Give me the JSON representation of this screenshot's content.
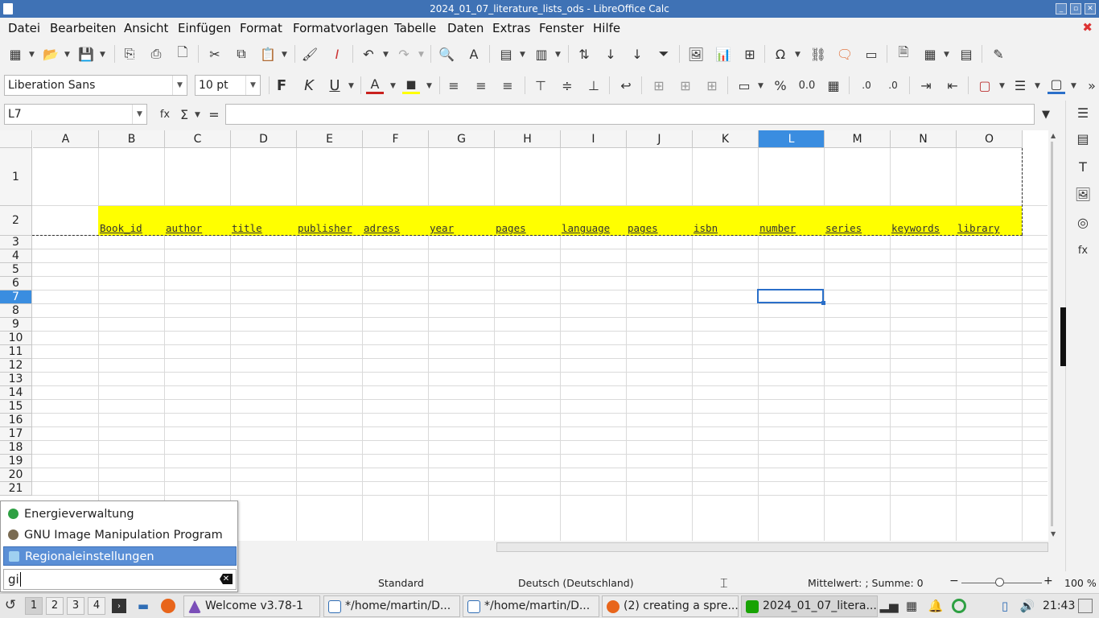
{
  "window": {
    "title": "2024_01_07_literature_lists_ods - LibreOffice Calc"
  },
  "menu": [
    "Datei",
    "Bearbeiten",
    "Ansicht",
    "Einfügen",
    "Format",
    "Formatvorlagen",
    "Tabelle",
    "Daten",
    "Extras",
    "Fenster",
    "Hilfe"
  ],
  "font": {
    "name": "Liberation Sans",
    "size": "10 pt"
  },
  "formula": {
    "cell_ref": "L7",
    "content": ""
  },
  "columns": [
    "A",
    "B",
    "C",
    "D",
    "E",
    "F",
    "G",
    "H",
    "I",
    "J",
    "K",
    "L",
    "M",
    "N",
    "O"
  ],
  "selected_column": "L",
  "rows": [
    "1",
    "2",
    "3",
    "4",
    "5",
    "6",
    "7",
    "8",
    "9",
    "10",
    "11",
    "12",
    "13",
    "14",
    "15",
    "16",
    "17",
    "18",
    "19",
    "20",
    "21"
  ],
  "selected_row": "7",
  "header_cells": [
    "Book_id",
    "author",
    "title",
    "publisher",
    "adress",
    "year",
    "pages",
    "language",
    "pages",
    "isbn",
    "number",
    "series",
    "keywords",
    "library"
  ],
  "header_fill": "#ffff00",
  "status": {
    "style": "Standard",
    "language": "Deutsch (Deutschland)",
    "sum": "Mittelwert: ; Summe: 0",
    "zoom": "100 %"
  },
  "popup": {
    "items": [
      "Energieverwaltung",
      "GNU Image Manipulation Program",
      "Regionaleinstellungen"
    ],
    "highlighted": "Regionaleinstellungen",
    "search_text": "gi"
  },
  "taskbar": {
    "workspaces": [
      "1",
      "2",
      "3",
      "4"
    ],
    "tasks": [
      "Welcome v3.78-1",
      "*/home/martin/D...",
      "*/home/martin/D...",
      "(2) creating a spre...",
      "2024_01_07_litera..."
    ],
    "clock": "21:43"
  }
}
